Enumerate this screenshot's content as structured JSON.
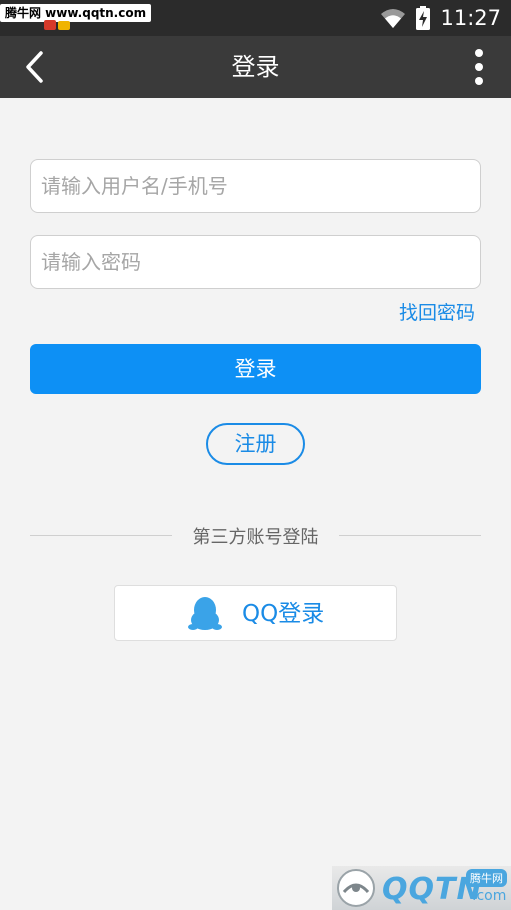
{
  "status_bar": {
    "watermark_text": "腾牛网 www.qqtn.com",
    "time": "11:27",
    "icons": [
      "wifi-icon",
      "battery-charging-icon"
    ]
  },
  "app_bar": {
    "title": "登录",
    "back_icon": "chevron-left-icon",
    "more_icon": "more-vertical-icon"
  },
  "form": {
    "username": {
      "value": "",
      "placeholder": "请输入用户名/手机号"
    },
    "password": {
      "value": "",
      "placeholder": "请输入密码"
    },
    "forgot_label": "找回密码",
    "login_label": "登录",
    "register_label": "注册"
  },
  "third_party": {
    "label": "第三方账号登陆",
    "qq_label": "QQ登录",
    "qq_icon": "qq-penguin-icon"
  },
  "watermark_bottom": {
    "brand": "QQTN",
    "domain": ".com",
    "tag": "腾牛网"
  },
  "colors": {
    "accent": "#0d90f5",
    "link": "#1a8be6",
    "app_bar": "#3a3a3a",
    "status_bar": "#2b2b2b",
    "background": "#f3f3f3"
  }
}
